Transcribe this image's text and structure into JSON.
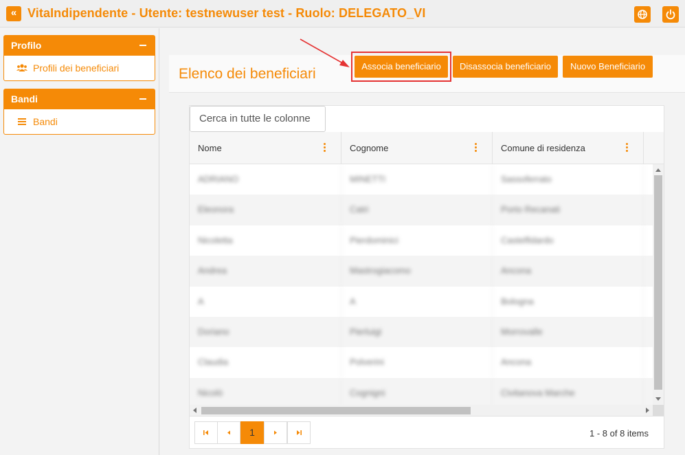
{
  "header": {
    "collapse_icon": "«",
    "title": "VitaIndipendente - Utente: testnewuser test - Ruolo: DELEGATO_VI",
    "globe_icon": "globe-icon",
    "power_icon": "power-icon"
  },
  "sidebar": {
    "panels": [
      {
        "title": "Profilo",
        "items": [
          {
            "label": "Profili dei beneficiari",
            "icon": "users-icon"
          }
        ]
      },
      {
        "title": "Bandi",
        "items": [
          {
            "label": "Bandi",
            "icon": "list-icon"
          }
        ]
      }
    ]
  },
  "main": {
    "page_title": "Elenco dei beneficiari",
    "buttons": {
      "associa": "Associa beneficiario",
      "disassocia": "Disassocia beneficiario",
      "nuovo": "Nuovo Beneficiario"
    }
  },
  "grid": {
    "search_placeholder": "Cerca in tutte le colonne",
    "columns": [
      "Nome",
      "Cognome",
      "Comune di residenza"
    ],
    "rows": [
      [
        "ADRIANO",
        "MINETTI",
        "Sassoferrato"
      ],
      [
        "Eleonora",
        "Catri",
        "Porto Recanati"
      ],
      [
        "Nicoletta",
        "Pierdominici",
        "Castelfidardo"
      ],
      [
        "Andrea",
        "Mastrogiacomo",
        "Ancona"
      ],
      [
        "A",
        "A",
        "Bologna"
      ],
      [
        "Doriano",
        "Pierluigi",
        "Morrovalle"
      ],
      [
        "Claudia",
        "Polverini",
        "Ancona"
      ],
      [
        "Nicolò",
        "Cognigni",
        "Civitanova Marche"
      ]
    ],
    "pager": {
      "first": "⏮",
      "prev": "◀",
      "page": "1",
      "next": "▶",
      "last": "⏭",
      "info": "1 - 8 of 8 items"
    }
  },
  "colors": {
    "accent": "#f58a07",
    "highlight": "#e53333"
  }
}
